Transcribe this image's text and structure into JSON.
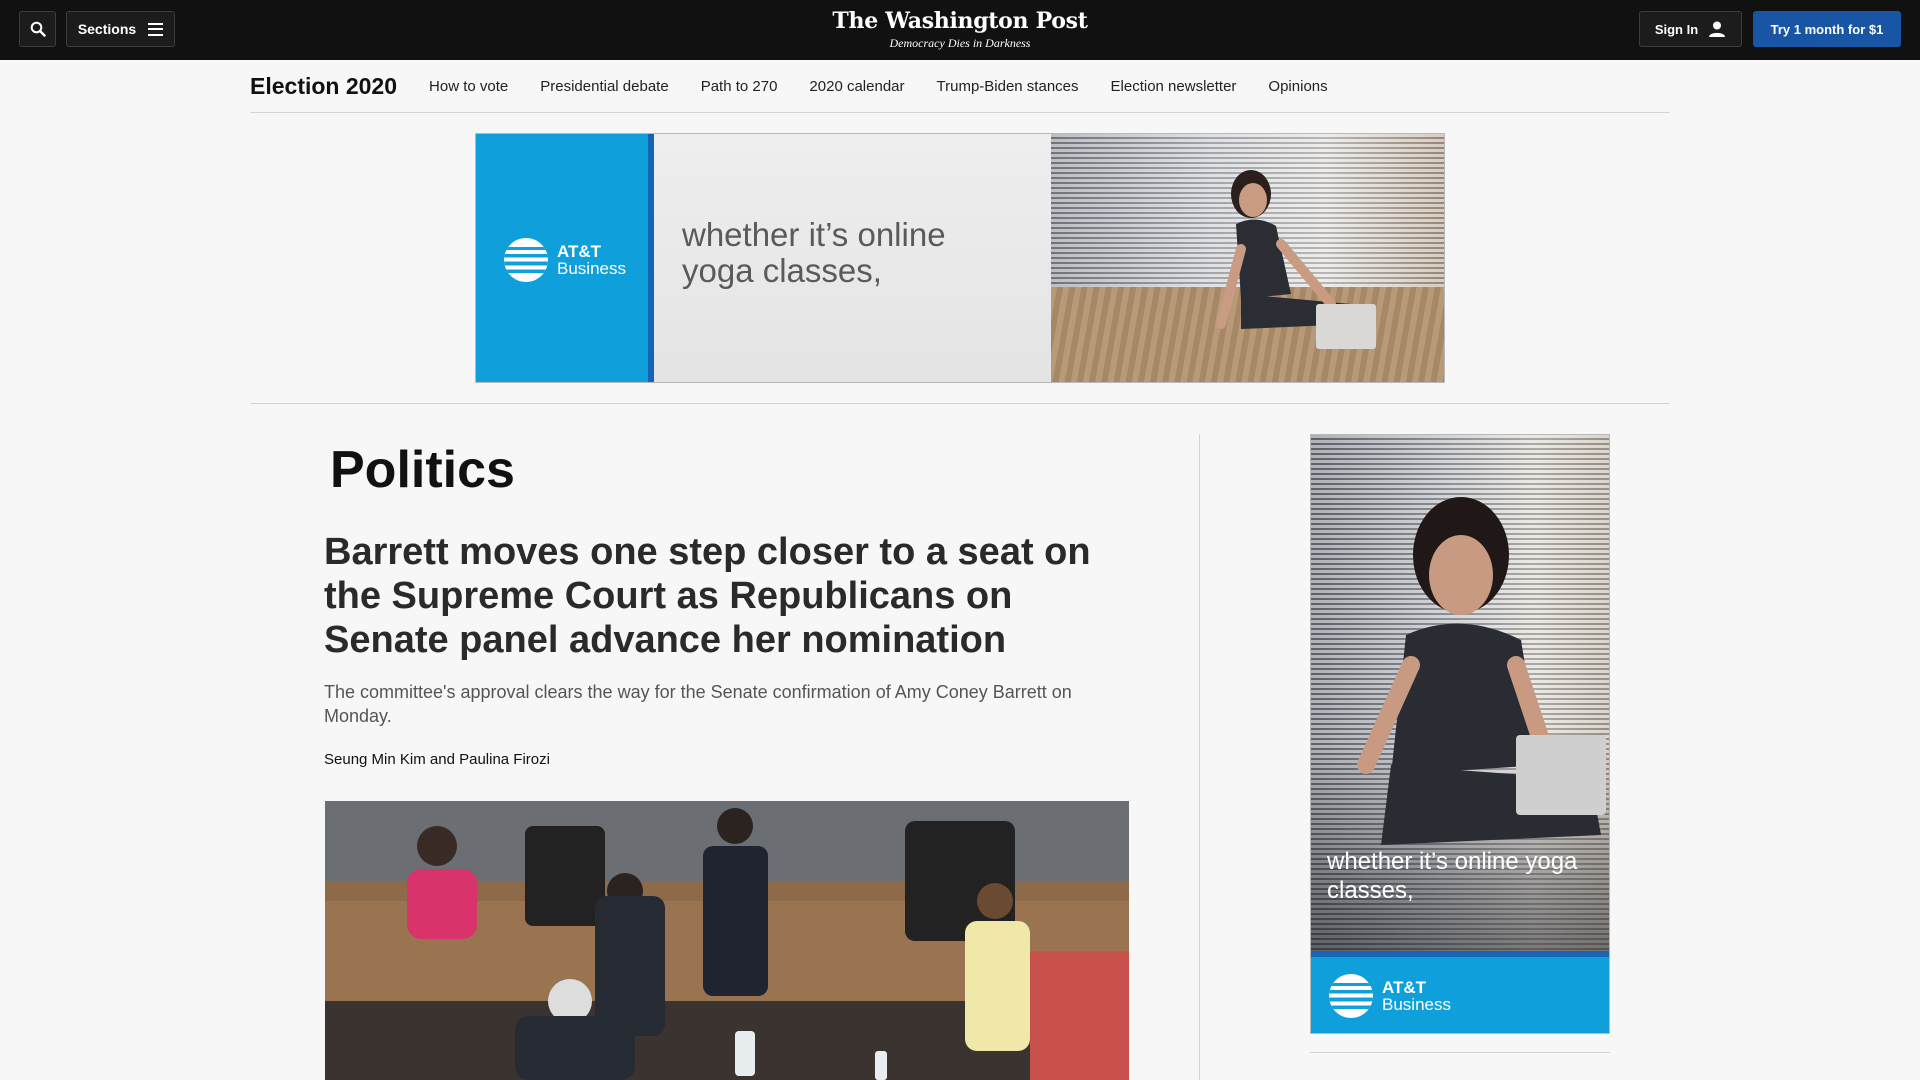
{
  "topbar": {
    "sections_label": "Sections",
    "logo": "The Washington Post",
    "tagline": "Democracy Dies in Darkness",
    "signin_label": "Sign In",
    "subscribe_label": "Try 1 month for $1",
    "colors": {
      "bar": "#111111",
      "subscribe": "#1955a5"
    },
    "icons": [
      "search-icon",
      "hamburger-icon",
      "user-icon"
    ]
  },
  "election_nav": {
    "title": "Election 2020",
    "links": [
      {
        "label": "How to vote"
      },
      {
        "label": "Presidential debate"
      },
      {
        "label": "Path to 270"
      },
      {
        "label": "2020 calendar"
      },
      {
        "label": "Trump-Biden stances"
      },
      {
        "label": "Election newsletter"
      },
      {
        "label": "Opinions"
      }
    ]
  },
  "ads": {
    "top": {
      "copy": "whether it’s online yoga classes,",
      "brand_line1": "AT&T",
      "brand_line2": "Business"
    },
    "side": {
      "copy": "whether it’s online yoga classes,",
      "brand_line1": "AT&T",
      "brand_line2": "Business"
    },
    "colors": {
      "brand_blue": "#0fa0dc",
      "stripe": "#1564b6"
    }
  },
  "article": {
    "section": "Politics",
    "headline": "Barrett moves one step closer to a seat on the Supreme Court as Republicans on Senate panel advance her nomination",
    "dek": "The committee's approval clears the way for the Senate confirmation of Amy Coney Barrett on Monday.",
    "authors": [
      "Seung Min Kim",
      "Paulina Firozi"
    ],
    "byline_joiner": "and"
  }
}
